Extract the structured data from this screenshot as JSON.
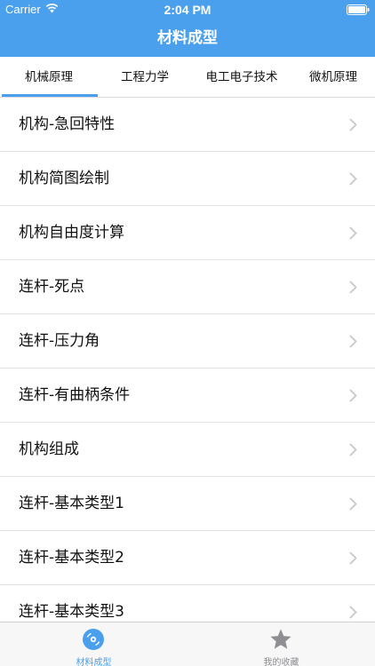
{
  "status_bar": {
    "carrier": "Carrier",
    "time": "2:04 PM"
  },
  "nav": {
    "title": "材料成型"
  },
  "tabs": [
    {
      "label": "机械原理",
      "selected": true
    },
    {
      "label": "工程力学",
      "selected": false
    },
    {
      "label": "电工电子技术",
      "selected": false
    },
    {
      "label": "微机原理",
      "selected": false
    }
  ],
  "list": {
    "items": [
      {
        "label": "机构-急回特性"
      },
      {
        "label": "机构简图绘制"
      },
      {
        "label": "机构自由度计算"
      },
      {
        "label": "连杆-死点"
      },
      {
        "label": "连杆-压力角"
      },
      {
        "label": "连杆-有曲柄条件"
      },
      {
        "label": "机构组成"
      },
      {
        "label": "连杆-基本类型1"
      },
      {
        "label": "连杆-基本类型2"
      },
      {
        "label": "连杆-基本类型3"
      }
    ],
    "chevron_icon": "chevron-right-icon"
  },
  "tabbar": {
    "items": [
      {
        "label": "材料成型",
        "icon": "disc-icon",
        "selected": true
      },
      {
        "label": "我的收藏",
        "icon": "star-icon",
        "selected": false
      }
    ]
  },
  "colors": {
    "accent": "#4aa0ec",
    "inactive": "#8e8e93",
    "divider": "#e2e2e2"
  }
}
